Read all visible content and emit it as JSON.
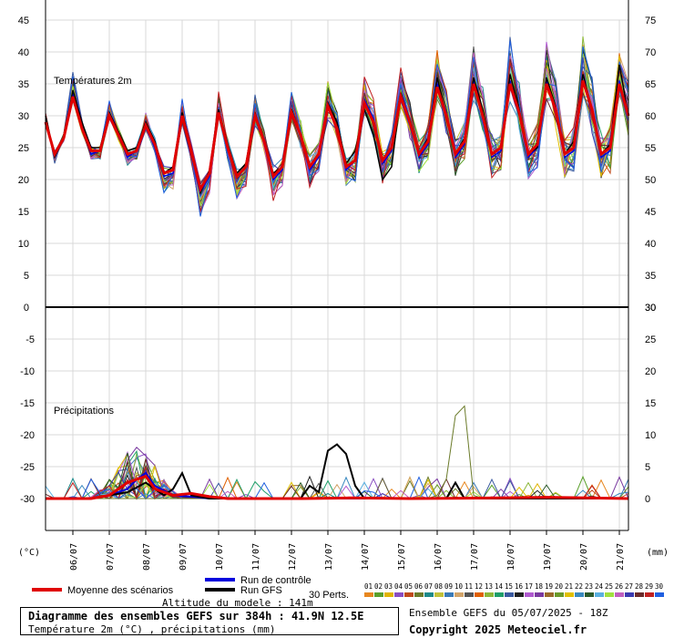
{
  "chart_data": [
    {
      "type": "line",
      "title": "Températures 2m",
      "xlabel": "",
      "ylabel": "(°C)",
      "y2label": "",
      "ylim": [
        0,
        45
      ],
      "y2lim": [
        30,
        75
      ],
      "yticks": [
        0,
        5,
        10,
        15,
        20,
        25,
        30,
        35,
        40,
        45
      ],
      "y2ticks": [
        30,
        35,
        40,
        45,
        50,
        55,
        60,
        65,
        70,
        75
      ],
      "x_hours_range": [
        0,
        384
      ],
      "dates": [
        "06/07",
        "07/07",
        "08/07",
        "09/07",
        "10/07",
        "11/07",
        "12/07",
        "13/07",
        "14/07",
        "15/07",
        "16/07",
        "17/07",
        "18/07",
        "19/07",
        "20/07",
        "21/07"
      ],
      "series": [
        {
          "name": "Moyenne des scénarios",
          "color": "#e00000",
          "step_hours": 6,
          "values": [
            29.0,
            24.0,
            26.5,
            33.0,
            28.0,
            24.5,
            24.5,
            30.0,
            27.0,
            24.0,
            24.5,
            28.5,
            25.5,
            21.0,
            21.5,
            30.0,
            24.5,
            18.5,
            21.0,
            30.5,
            25.0,
            20.5,
            22.0,
            30.0,
            26.0,
            20.5,
            22.0,
            30.5,
            27.0,
            22.0,
            24.0,
            31.5,
            28.0,
            22.0,
            23.0,
            32.0,
            29.0,
            23.0,
            25.0,
            33.0,
            29.0,
            24.0,
            26.0,
            34.5,
            30.0,
            24.0,
            26.0,
            35.0,
            30.0,
            24.0,
            25.0,
            35.0,
            30.5,
            24.0,
            25.5,
            35.0,
            31.0,
            24.0,
            25.0,
            35.5,
            31.0,
            24.0,
            25.0,
            35.0,
            30.0
          ]
        },
        {
          "name": "Run GFS",
          "color": "#000000",
          "step_hours": 6,
          "values": [
            30.0,
            23.5,
            26.5,
            34.0,
            29.0,
            25.0,
            25.0,
            30.5,
            27.5,
            24.5,
            25.0,
            29.0,
            26.0,
            21.0,
            22.0,
            30.5,
            25.0,
            18.0,
            21.5,
            31.0,
            25.5,
            21.0,
            22.5,
            30.5,
            26.0,
            21.0,
            22.0,
            31.0,
            27.0,
            22.0,
            24.0,
            32.0,
            29.0,
            22.5,
            24.5,
            31.0,
            27.0,
            20.0,
            22.0,
            33.5,
            29.0,
            24.0,
            26.5,
            36.0,
            30.0,
            24.0,
            26.5,
            36.0,
            31.0,
            24.0,
            25.0,
            36.5,
            31.0,
            24.0,
            25.0,
            36.0,
            31.5,
            24.0,
            26.0,
            36.5,
            31.0,
            24.0,
            25.5,
            38.0,
            30.0
          ]
        },
        {
          "name": "Run de contrôle",
          "color": "#0000dd",
          "step_hours": 6,
          "values": [
            29.0,
            24.0,
            26.5,
            33.5,
            28.0,
            24.0,
            24.5,
            30.5,
            27.0,
            23.5,
            24.5,
            28.5,
            25.0,
            20.5,
            21.0,
            30.0,
            24.0,
            18.0,
            20.5,
            30.5,
            25.0,
            20.5,
            22.0,
            30.0,
            26.0,
            20.0,
            21.5,
            30.5,
            27.0,
            21.5,
            23.5,
            32.0,
            28.0,
            21.5,
            23.0,
            32.5,
            29.5,
            22.5,
            24.5,
            33.5,
            29.5,
            23.5,
            25.5,
            35.0,
            30.5,
            23.5,
            25.5,
            35.5,
            30.0,
            23.5,
            24.5,
            35.5,
            30.0,
            23.5,
            25.0,
            35.5,
            30.5,
            23.5,
            24.5,
            35.5,
            30.5,
            23.5,
            24.5,
            35.5,
            30.0
          ]
        }
      ]
    },
    {
      "type": "line",
      "title": "Précipitations",
      "xlabel": "",
      "ylabel": "(°C)",
      "y2label": "(mm)",
      "ylim": [
        -35,
        0
      ],
      "y2lim": [
        -5,
        30
      ],
      "yticks": [
        -30,
        -25,
        -20,
        -15,
        -10,
        -5,
        0
      ],
      "y2ticks": [
        0,
        5,
        10,
        15,
        20,
        25,
        30
      ],
      "x_hours_range": [
        0,
        384
      ],
      "series": [
        {
          "name": "Moyenne des scénarios",
          "color": "#e00000",
          "points_hours_mm": [
            [
              0,
              0
            ],
            [
              30,
              0
            ],
            [
              42,
              0.5
            ],
            [
              54,
              2.5
            ],
            [
              66,
              3.5
            ],
            [
              72,
              1.5
            ],
            [
              84,
              0.5
            ],
            [
              96,
              0.8
            ],
            [
              108,
              0.3
            ],
            [
              120,
              0
            ],
            [
              170,
              0
            ],
            [
              200,
              0.1
            ],
            [
              240,
              0
            ],
            [
              300,
              0.1
            ],
            [
              330,
              0.2
            ],
            [
              384,
              0
            ]
          ]
        },
        {
          "name": "Run GFS",
          "color": "#000000",
          "points_hours_mm": [
            [
              0,
              0
            ],
            [
              30,
              0
            ],
            [
              54,
              1
            ],
            [
              66,
              2.5
            ],
            [
              78,
              0.5
            ],
            [
              84,
              1.5
            ],
            [
              90,
              4
            ],
            [
              96,
              0.5
            ],
            [
              108,
              0
            ],
            [
              168,
              0
            ],
            [
              174,
              2
            ],
            [
              180,
              1
            ],
            [
              186,
              7.5
            ],
            [
              192,
              8.5
            ],
            [
              198,
              7
            ],
            [
              204,
              2
            ],
            [
              210,
              0
            ],
            [
              264,
              0
            ],
            [
              270,
              2.5
            ],
            [
              276,
              0
            ],
            [
              384,
              0
            ]
          ]
        },
        {
          "name": "Run de contrôle",
          "color": "#0000dd",
          "points_hours_mm": [
            [
              0,
              0
            ],
            [
              30,
              0
            ],
            [
              42,
              0.5
            ],
            [
              54,
              1.5
            ],
            [
              60,
              3
            ],
            [
              66,
              4
            ],
            [
              72,
              2
            ],
            [
              84,
              0.5
            ],
            [
              96,
              0.3
            ],
            [
              108,
              0
            ],
            [
              384,
              0
            ]
          ]
        }
      ]
    }
  ],
  "legend": {
    "mean_label": "Moyenne des scénarios",
    "control_label": "Run de contrôle",
    "gfs_label": "Run GFS",
    "perts_label": "30 Perts.",
    "perts_numbers": [
      "01",
      "02",
      "03",
      "04",
      "05",
      "06",
      "07",
      "08",
      "09",
      "10",
      "11",
      "12",
      "13",
      "14",
      "15",
      "16",
      "17",
      "18",
      "19",
      "20",
      "21",
      "22",
      "23",
      "24",
      "25",
      "26",
      "27",
      "28",
      "29",
      "30"
    ],
    "perts_colors": [
      "#e7871f",
      "#5aa02c",
      "#e0b400",
      "#8a4ec2",
      "#c04a1a",
      "#6b7b2a",
      "#1c8a8a",
      "#c2c23a",
      "#3a7ab8",
      "#d2a46a",
      "#555555",
      "#e06000",
      "#8db83a",
      "#1f9f6a",
      "#3a5aa0",
      "#202020",
      "#b05ad0",
      "#7a3aa0",
      "#9a6a2a",
      "#6a9a2a",
      "#e0c000",
      "#3a8ac0",
      "#2a5a2a",
      "#5ab0e0",
      "#a0e040",
      "#c060c0",
      "#3a3ab0",
      "#6a2a2a",
      "#c02020",
      "#2060e0"
    ]
  },
  "unit_left": "(°C)",
  "unit_right": "(mm)",
  "altitude": "Altitude du modele : 141m",
  "info": {
    "title": "Diagramme des ensembles GEFS sur 384h : 41.9N 12.5E",
    "subtitle": "Température 2m (°C) , précipitations (mm)"
  },
  "run_info": "Ensemble GEFS du 05/07/2025 - 18Z",
  "copyright": "Copyright 2025 Meteociel.fr"
}
